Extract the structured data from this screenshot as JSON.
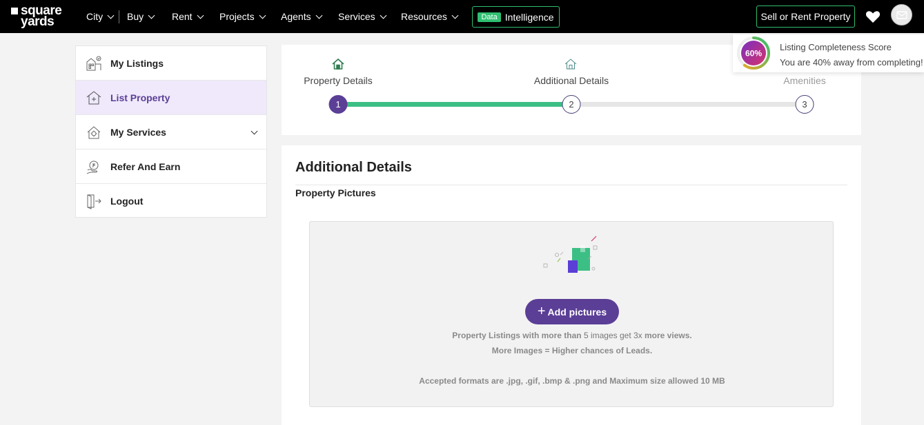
{
  "logo": {
    "line1": "square",
    "line2": "yards"
  },
  "nav": {
    "items": [
      {
        "label": "City"
      },
      {
        "label": "Buy"
      },
      {
        "label": "Rent"
      },
      {
        "label": "Projects"
      },
      {
        "label": "Agents"
      },
      {
        "label": "Services"
      },
      {
        "label": "Resources"
      }
    ],
    "data_badge": "Data",
    "data_label": "Intelligence",
    "sell_label": "Sell or Rent Property"
  },
  "sidebar": {
    "items": [
      {
        "label": "My Listings",
        "icon": "listings-icon"
      },
      {
        "label": "List Property",
        "icon": "house-plus-icon",
        "active": true
      },
      {
        "label": "My Services",
        "icon": "services-icon",
        "expandable": true
      },
      {
        "label": "Refer And Earn",
        "icon": "refer-icon"
      },
      {
        "label": "Logout",
        "icon": "logout-icon"
      }
    ]
  },
  "stepper": {
    "steps": [
      {
        "number": "1",
        "label": "Property Details",
        "state": "done"
      },
      {
        "number": "2",
        "label": "Additional Details",
        "state": "current"
      },
      {
        "number": "3",
        "label": "Amenities",
        "state": "todo"
      }
    ],
    "progress_fraction": 0.5
  },
  "score": {
    "percent_label": "60%",
    "percent": 60,
    "title": "Listing Completeness Score",
    "subtitle": "You are 40% away from completing!"
  },
  "details": {
    "title": "Additional Details",
    "section": "Property Pictures",
    "add_button": "Add pictures",
    "info1_a": "Property Listings with more than ",
    "info1_b": "5 images get 3x",
    "info1_c": " more views.",
    "info2": "More Images = Higher chances of Leads.",
    "info3": "Accepted formats are .jpg, .gif, .bmp & .png and Maximum size allowed 10 MB"
  },
  "colors": {
    "brand": "#5b3e96",
    "green": "#3cbf85",
    "active_bg": "#efe9fb"
  }
}
